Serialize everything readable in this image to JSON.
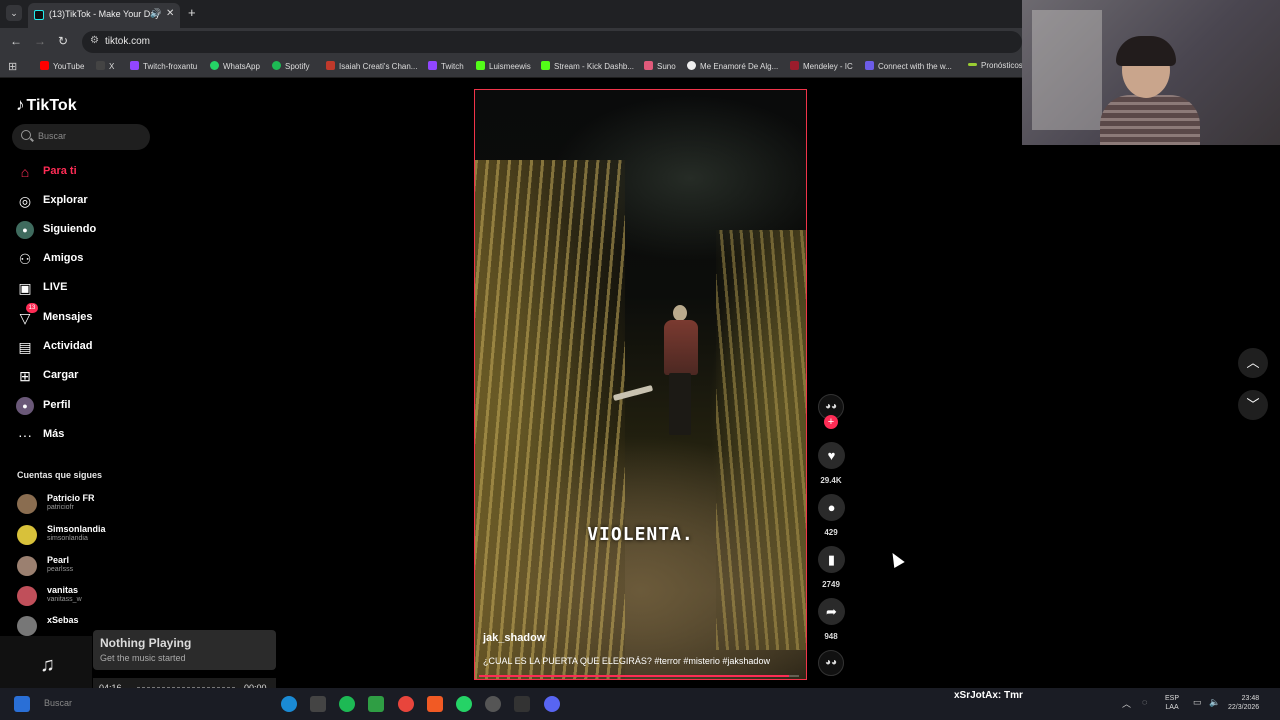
{
  "browser": {
    "tab_title": "(13)TikTok - Make Your Day",
    "url": "tiktok.com",
    "bookmarks": [
      {
        "label": "YouTube",
        "color": "#ff0000"
      },
      {
        "label": "X",
        "color": "#111111"
      },
      {
        "label": "Twitch-froxantu",
        "color": "#9146ff"
      },
      {
        "label": "WhatsApp",
        "color": "#25d366"
      },
      {
        "label": "Spotify",
        "color": "#1db954"
      },
      {
        "label": "Isaiah Creati's Chan...",
        "color": "#c0392b"
      },
      {
        "label": "Twitch",
        "color": "#9146ff"
      },
      {
        "label": "Luismeewis",
        "color": "#53fc18"
      },
      {
        "label": "Stream - Kick Dashb...",
        "color": "#53fc18"
      },
      {
        "label": "Suno",
        "color": "#e05a7a"
      },
      {
        "label": "Me Enamoré De Alg...",
        "color": "#eeeeee"
      },
      {
        "label": "Mendeley - IC",
        "color": "#9b1c2c"
      },
      {
        "label": "Connect with the w...",
        "color": "#6c5ce7"
      },
      {
        "label": "Pronósticos",
        "color": "#9acd32"
      }
    ]
  },
  "tiktok": {
    "logo": "TikTok",
    "search_placeholder": "Buscar",
    "menu": [
      {
        "label": "Para ti",
        "icon": "home-icon"
      },
      {
        "label": "Explorar",
        "icon": "compass-icon"
      },
      {
        "label": "Siguiendo",
        "icon": "following-icon"
      },
      {
        "label": "Amigos",
        "icon": "friends-icon"
      },
      {
        "label": "LIVE",
        "icon": "live-icon"
      },
      {
        "label": "Mensajes",
        "icon": "messages-icon",
        "badge": "13"
      },
      {
        "label": "Actividad",
        "icon": "activity-icon"
      },
      {
        "label": "Cargar",
        "icon": "upload-icon"
      },
      {
        "label": "Perfil",
        "icon": "profile-icon"
      },
      {
        "label": "Más",
        "icon": "more-icon"
      }
    ],
    "following_title": "Cuentas que sigues",
    "following": [
      {
        "name": "Patricio FR",
        "handle": "patriciofr",
        "color": "#8a6d50"
      },
      {
        "name": "Simsonlandia",
        "handle": "simsonlandia",
        "color": "#d8c13a"
      },
      {
        "name": "Pearl",
        "handle": "pearlsss",
        "color": "#9b8070"
      },
      {
        "name": "vanitas",
        "handle": "vanitass_w",
        "color": "#c04f5a"
      },
      {
        "name": "xSebas",
        "handle": "",
        "color": "#777777"
      }
    ],
    "video": {
      "caption_overlay": "VIOLENTA.",
      "author": "jak_shadow",
      "description": "¿CUAL ES LA PUERTA QUE ELEGIRÁS? #terror #misterio #jakshadow",
      "progress": 0.97
    },
    "actions": {
      "likes": "29.4K",
      "comments": "429",
      "saves": "2749",
      "shares": "948"
    }
  },
  "music_widget": {
    "title": "Nothing Playing",
    "subtitle": "Get the music started",
    "elapsed": "04:16",
    "remaining": "00:00"
  },
  "taskbar": {
    "search": "Buscar",
    "stream_label": "xSrJotAx: Tmr",
    "lang_top": "ESP",
    "lang_bottom": "LAA",
    "time": "23:48",
    "date": "22/3/2026"
  }
}
